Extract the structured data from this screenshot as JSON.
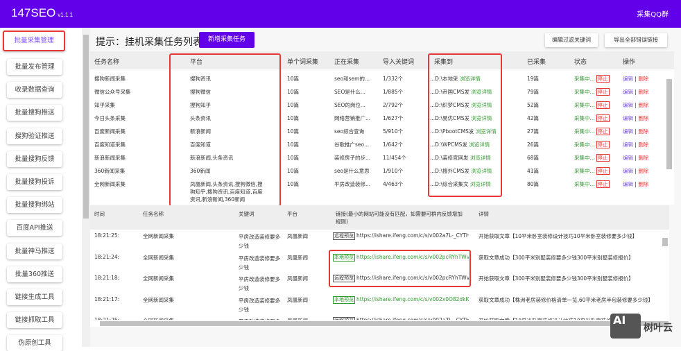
{
  "app": {
    "name": "147SEO",
    "version": "v1.1.1",
    "qq_group": "采集QQ群"
  },
  "sidebar": {
    "items": [
      "批量采集管理",
      "批量发布管理",
      "收录数据查询",
      "批量搜狗推送",
      "搜狗验证推送",
      "批量搜狗反馈",
      "批量搜狗投诉",
      "批量搜狗绑站",
      "百度API推送",
      "批量神马推送",
      "批量360推送",
      "链接生成工具",
      "链接抓取工具",
      "伪原创工具"
    ]
  },
  "header": {
    "title": "提示：挂机采集任务列表",
    "new_task": "新增采集任务",
    "edit_filter": "编辑过滤关键词",
    "export_errors": "导出全部错误链接"
  },
  "tasks": {
    "columns": [
      "任务名称",
      "平台",
      "单个词采集",
      "正在采集",
      "导入关键词",
      "采集到",
      "已采集",
      "状态",
      "操作"
    ],
    "browse_label": "浏览详情",
    "status_label": "采集中...",
    "stop_label": "停止",
    "edit_label": "编辑",
    "sep": "|",
    "delete_label": "删除",
    "rows": [
      {
        "name": "搜狗新闻采集",
        "platform": "搜狗资讯",
        "per": "10篇",
        "current": "seo和sem的...",
        "keywords": "1/332个",
        "target": "...D:\\本地采",
        "count": "19篇"
      },
      {
        "name": "微信公众号采集",
        "platform": "搜狗微信",
        "per": "10篇",
        "current": "SEO是什么...",
        "keywords": "1/885个",
        "target": "...D:\\帝国CMS发",
        "count": "79篇"
      },
      {
        "name": "知乎采集",
        "platform": "搜狗知乎",
        "per": "10篇",
        "current": "SEO的岗位...",
        "keywords": "2/792个",
        "target": "...D:\\织梦CMS发",
        "count": "52篇"
      },
      {
        "name": "今日头条采集",
        "platform": "头条资讯",
        "per": "10篇",
        "current": "网络营销推广...",
        "keywords": "1/627个",
        "target": "...D:\\易优CMS发",
        "count": "42篇"
      },
      {
        "name": "百度新闻采集",
        "platform": "新浪新闻",
        "per": "10篇",
        "current": "seo综合查询",
        "keywords": "5/910个",
        "target": "...D:\\PbootCMS发",
        "count": "27篇"
      },
      {
        "name": "百度知道采集",
        "platform": "百度知道",
        "per": "10篇",
        "current": "谷歌推广seo...",
        "keywords": "1/642个",
        "target": "...D:\\WPCMS发",
        "count": "26篇"
      },
      {
        "name": "新浪新闻采集",
        "platform": "新浪新闻,头条资讯",
        "per": "10篇",
        "current": "装修房子的步...",
        "keywords": "11/454个",
        "target": "...D:\\装修官网发",
        "count": "68篇"
      },
      {
        "name": "360新闻采集",
        "platform": "360新闻",
        "per": "10篇",
        "current": "seo是什么意思",
        "keywords": "1/910个",
        "target": "...D:\\搜外CMS发",
        "count": "41篇"
      },
      {
        "name": "全网新闻采集",
        "platform": "凤凰新闻,头条资讯,搜狗微信,搜狗知乎,搜狗资讯,百度知道,百度资讯,新浪新闻,360新闻",
        "per": "10篇",
        "current": "平房改造装修...",
        "keywords": "4/463个",
        "target": "...D:\\综合采集文",
        "count": "80篇"
      }
    ]
  },
  "log": {
    "columns": [
      "时间",
      "任务名称",
      "关键词",
      "平台",
      "链接(最小的网站可能没有匹配，如需要可群内反馈增加规则)",
      "详情"
    ],
    "rows": [
      {
        "time": "18:21:25:",
        "task": "全网新闻采集",
        "keyword": "平房改造装修要多少钱",
        "platform": "凤凰新闻",
        "tag": "远程预览",
        "local": false,
        "url": "https://ishare.ifeng.com/c/s/v002a7L-_CYTH...",
        "detail": "开始获取文章【10平米卧室装修设计技巧10平米卧室装修要多少钱】"
      },
      {
        "time": "18:21:24:",
        "task": "全网新闻采集",
        "keyword": "平房改造装修要多少钱",
        "platform": "凤凰新闻",
        "tag": "本地预览",
        "local": true,
        "url": "https://ishare.ifeng.com/c/s/v002pcRYhTWvri...",
        "detail": "获取文章成功【300平米别墅装修要多少钱300平米别墅装修报价】"
      },
      {
        "time": "18:21:18:",
        "task": "全网新闻采集",
        "keyword": "平房改造装修要多少钱",
        "platform": "凤凰新闻",
        "tag": "远程预览",
        "local": false,
        "url": "https://ishare.ifeng.com/c/s/v002pcRYhTWvri...",
        "detail": "开始获取文章【300平米别墅装修要多少钱300平米别墅装修报价】"
      },
      {
        "time": "18:21:17:",
        "task": "全网新闻采集",
        "keyword": "平房改造装修要多少钱",
        "platform": "凤凰新闻",
        "tag": "本地预览",
        "local": true,
        "url": "https://ishare.ifeng.com/c/s/v002x0O82dkKm...",
        "detail": "获取文章成功【株洲老房装修价格清单一览,60平米老房半包装修要多少钱】"
      }
    ]
  },
  "watermark": {
    "text": "树叶云",
    "badge": "AI"
  },
  "colors": {
    "brand": "#6200ea",
    "green": "#2e9a2e",
    "red": "#e53935",
    "purple": "#7c4dff"
  }
}
